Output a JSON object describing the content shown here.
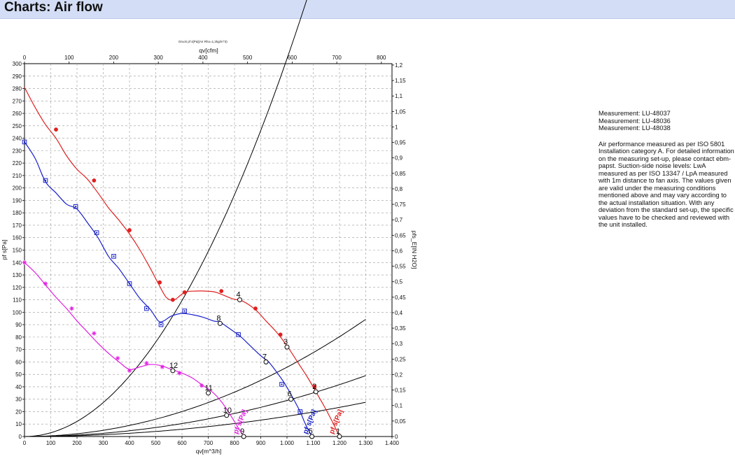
{
  "page": {
    "title": "Charts: Air flow"
  },
  "notes": {
    "measurements": [
      "Measurement: LU-48037",
      "Measurement: LU-48036",
      "Measurement: LU-48038"
    ],
    "description": "Air performance measured as per ISO 5801 Installation category A. For detailed information on the measuring set-up, please contact ebm-papst. Suction-side noise levels: LwA measured as per ISO 13347 / LpA measured with 1m distance to fan axis. The values given are valid under the measuring conditions mentioned above and may vary according to the actual installation situation. With any deviation from the standard set-up, the specific values have to be checked and reviewed with the unit installed."
  },
  "chart_data": {
    "type": "line",
    "subtitle": "Druck pf s[Pa](Air Rho=1,2kg/m^3)",
    "xlabel": "qv[m^3/h]",
    "xlabel_top": "qv[cfm]",
    "ylabel": "pf s[Pa]",
    "ylabel_right": "pfs_E[IN H2O]",
    "xlim": [
      0,
      1400
    ],
    "ylim": [
      0,
      300
    ],
    "xlim_top": [
      0,
      823.8
    ],
    "ylim_right": [
      0,
      1.2044
    ],
    "x_ticks": [
      0,
      100,
      200,
      300,
      400,
      500,
      600,
      700,
      800,
      900,
      1000,
      1100,
      1200,
      1300,
      1400
    ],
    "x_tick_labels": [
      "0",
      "100",
      "200",
      "300",
      "400",
      "500",
      "600",
      "700",
      "800",
      "900",
      "1.000",
      "1.100",
      "1.200",
      "1.300",
      "1.400"
    ],
    "y_ticks": [
      0,
      10,
      20,
      30,
      40,
      50,
      60,
      70,
      80,
      90,
      100,
      110,
      120,
      130,
      140,
      150,
      160,
      170,
      180,
      190,
      200,
      210,
      220,
      230,
      240,
      250,
      260,
      270,
      280,
      290,
      300
    ],
    "x_top_ticks": [
      0,
      100,
      200,
      300,
      400,
      500,
      600,
      700,
      800
    ],
    "y_right_ticks": [
      0,
      0.05,
      0.1,
      0.15,
      0.2,
      0.25,
      0.3,
      0.35,
      0.4,
      0.45,
      0.5,
      0.55,
      0.6,
      0.65,
      0.7,
      0.75,
      0.8,
      0.85,
      0.9,
      0.95,
      1,
      1.05,
      1.1,
      1.15,
      1.2
    ],
    "y_right_tick_labels": [
      "0",
      "0,05",
      "0,1",
      "0,15",
      "0,2",
      "0,25",
      "0,3",
      "0,35",
      "0,4",
      "0,45",
      "0,5",
      "0,55",
      "0,6",
      "0,65",
      "0,7",
      "0,75",
      "0,8",
      "0,85",
      "0,9",
      "0,95",
      "1",
      "1,05",
      "1,1",
      "1,15",
      "1,2"
    ],
    "grid": true,
    "series": [
      {
        "label": "pf s[Pa]",
        "color": "#e02020",
        "marker": "circle",
        "points": [
          [
            0,
            281
          ],
          [
            40,
            265
          ],
          [
            80,
            251
          ],
          [
            120,
            240
          ],
          [
            160,
            226
          ],
          [
            200,
            215
          ],
          [
            240,
            207
          ],
          [
            280,
            196
          ],
          [
            320,
            184
          ],
          [
            360,
            174
          ],
          [
            400,
            163
          ],
          [
            440,
            150
          ],
          [
            480,
            135
          ],
          [
            510,
            123
          ],
          [
            540,
            112
          ],
          [
            570,
            110
          ],
          [
            610,
            116
          ],
          [
            650,
            117
          ],
          [
            690,
            117
          ],
          [
            730,
            116
          ],
          [
            790,
            111
          ],
          [
            830,
            109
          ],
          [
            880,
            102
          ],
          [
            920,
            93
          ],
          [
            960,
            84
          ],
          [
            1000,
            73
          ],
          [
            1040,
            60
          ],
          [
            1080,
            47
          ],
          [
            1110,
            36
          ],
          [
            1140,
            25
          ],
          [
            1170,
            13
          ],
          [
            1200,
            0
          ]
        ],
        "markers": [
          [
            120,
            247
          ],
          [
            265,
            206
          ],
          [
            400,
            166
          ],
          [
            515,
            124
          ],
          [
            565,
            110
          ],
          [
            610,
            116
          ],
          [
            750,
            117
          ],
          [
            880,
            103
          ],
          [
            975,
            82
          ],
          [
            1105,
            40
          ]
        ],
        "curve_label_x": 1200
      },
      {
        "label": "pf s[Pa]",
        "color": "#1a22c8",
        "marker": "square",
        "points": [
          [
            0,
            237
          ],
          [
            40,
            224
          ],
          [
            80,
            205
          ],
          [
            120,
            196
          ],
          [
            160,
            187
          ],
          [
            200,
            183
          ],
          [
            240,
            172
          ],
          [
            280,
            160
          ],
          [
            320,
            145
          ],
          [
            360,
            135
          ],
          [
            400,
            123
          ],
          [
            440,
            111
          ],
          [
            480,
            102
          ],
          [
            510,
            93
          ],
          [
            530,
            93
          ],
          [
            560,
            97
          ],
          [
            600,
            99
          ],
          [
            640,
            98
          ],
          [
            680,
            96
          ],
          [
            720,
            93
          ],
          [
            745,
            92
          ],
          [
            780,
            87
          ],
          [
            820,
            81
          ],
          [
            860,
            73
          ],
          [
            900,
            65
          ],
          [
            930,
            60
          ],
          [
            960,
            52
          ],
          [
            990,
            43
          ],
          [
            1020,
            32
          ],
          [
            1050,
            20
          ],
          [
            1070,
            10
          ],
          [
            1095,
            0
          ]
        ],
        "markers": [
          [
            0,
            237
          ],
          [
            80,
            206
          ],
          [
            195,
            185
          ],
          [
            275,
            164
          ],
          [
            340,
            145
          ],
          [
            400,
            123
          ],
          [
            465,
            103
          ],
          [
            520,
            90
          ],
          [
            610,
            101
          ],
          [
            815,
            82
          ],
          [
            980,
            42
          ],
          [
            1050,
            20
          ]
        ],
        "curve_label_x": 1100
      },
      {
        "label": "pf s[Pa]",
        "color": "#e020e0",
        "marker": "asterisk",
        "points": [
          [
            0,
            140
          ],
          [
            40,
            132
          ],
          [
            80,
            122
          ],
          [
            120,
            112
          ],
          [
            160,
            103
          ],
          [
            200,
            93
          ],
          [
            240,
            84
          ],
          [
            280,
            75
          ],
          [
            320,
            67
          ],
          [
            360,
            60
          ],
          [
            400,
            54
          ],
          [
            440,
            56
          ],
          [
            480,
            58
          ],
          [
            520,
            57
          ],
          [
            560,
            54
          ],
          [
            600,
            51
          ],
          [
            640,
            47
          ],
          [
            680,
            41
          ],
          [
            720,
            35
          ],
          [
            750,
            28
          ],
          [
            770,
            22
          ],
          [
            800,
            12
          ],
          [
            820,
            5
          ],
          [
            835,
            0
          ]
        ],
        "markers": [
          [
            0,
            140
          ],
          [
            80,
            123
          ],
          [
            180,
            103
          ],
          [
            265,
            83
          ],
          [
            355,
            63
          ],
          [
            400,
            53
          ],
          [
            465,
            59
          ],
          [
            525,
            56
          ],
          [
            590,
            51
          ],
          [
            675,
            41
          ]
        ],
        "curve_label_x": 835
      }
    ],
    "system_curves": [
      {
        "label": "1",
        "k": 0.000304,
        "x_end": 1295
      },
      {
        "label": "2",
        "k": 5.58e-05,
        "x_end": 1300
      },
      {
        "label": "3",
        "k": 2.9e-05,
        "x_end": 1300
      },
      {
        "label": "4",
        "k": 1.63e-05,
        "x_end": 1300
      }
    ],
    "operating_points": [
      {
        "label": "1",
        "x": 1200,
        "y": 0
      },
      {
        "label": "2",
        "x": 1110,
        "y": 36
      },
      {
        "label": "3",
        "x": 1000,
        "y": 72
      },
      {
        "label": "4",
        "x": 820,
        "y": 110
      },
      {
        "label": "5",
        "x": 1095,
        "y": 0
      },
      {
        "label": "6",
        "x": 1015,
        "y": 30
      },
      {
        "label": "7",
        "x": 920,
        "y": 60
      },
      {
        "label": "8",
        "x": 745,
        "y": 91
      },
      {
        "label": "9",
        "x": 835,
        "y": 0
      },
      {
        "label": "10",
        "x": 770,
        "y": 17
      },
      {
        "label": "11",
        "x": 700,
        "y": 35
      },
      {
        "label": "12",
        "x": 565,
        "y": 53
      }
    ]
  }
}
